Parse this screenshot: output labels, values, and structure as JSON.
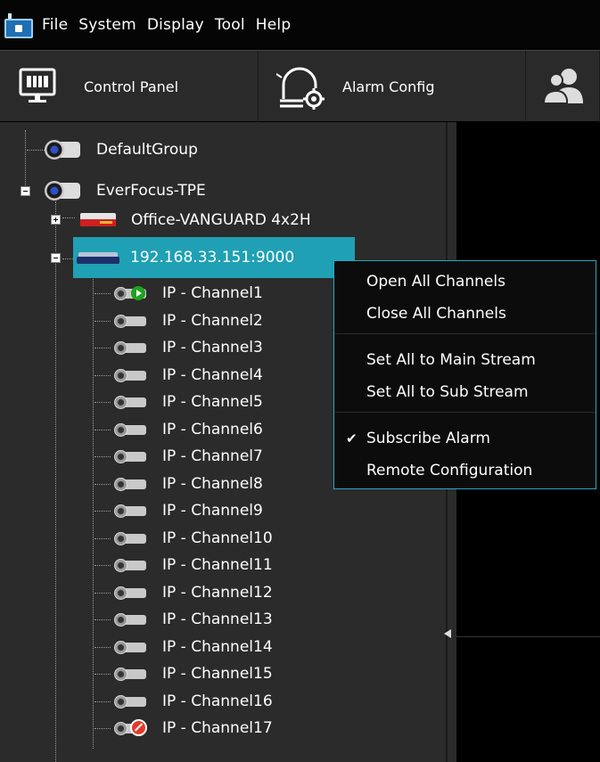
{
  "menubar": {
    "items": [
      "File",
      "System",
      "Display",
      "Tool",
      "Help"
    ]
  },
  "toolbar": {
    "control_panel": "Control Panel",
    "alarm_config": "Alarm Config"
  },
  "tree": {
    "default_group": "DefaultGroup",
    "site": "EverFocus-TPE",
    "dvr": "Office-VANGUARD 4x2H",
    "nvr": "192.168.33.151:9000",
    "channels": [
      "IP - Channel1",
      "IP - Channel2",
      "IP - Channel3",
      "IP - Channel4",
      "IP - Channel5",
      "IP - Channel6",
      "IP - Channel7",
      "IP - Channel8",
      "IP - Channel9",
      "IP - Channel10",
      "IP - Channel11",
      "IP - Channel12",
      "IP - Channel13",
      "IP - Channel14",
      "IP - Channel15",
      "IP - Channel16",
      "IP - Channel17"
    ]
  },
  "context_menu": {
    "open_all": "Open All Channels",
    "close_all": "Close All Channels",
    "main_stream": "Set All to Main Stream",
    "sub_stream": "Set All to Sub Stream",
    "subscribe_alarm": "Subscribe Alarm",
    "subscribe_checked": "✔",
    "remote_config": "Remote Configuration"
  }
}
